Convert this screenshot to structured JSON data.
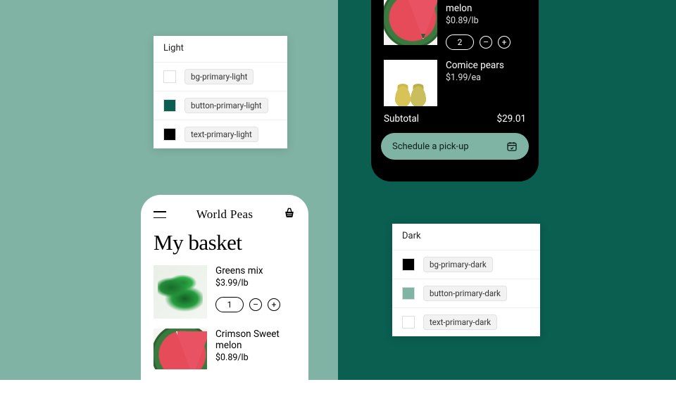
{
  "palettes": {
    "light": {
      "title": "Light",
      "rows": [
        {
          "token": "bg-primary-light",
          "hex": "#FFFFFF"
        },
        {
          "token": "button-primary-light",
          "hex": "#0A5F50"
        },
        {
          "token": "text-primary-light",
          "hex": "#000000"
        }
      ]
    },
    "dark": {
      "title": "Dark",
      "rows": [
        {
          "token": "bg-primary-dark",
          "hex": "#000000"
        },
        {
          "token": "button-primary-dark",
          "hex": "#7FB3A4"
        },
        {
          "token": "text-primary-dark",
          "hex": "#FFFFFF"
        }
      ]
    }
  },
  "light_phone": {
    "brand": "World Peas",
    "heading": "My basket",
    "items": [
      {
        "name": "Greens mix",
        "price": "$3.99/lb",
        "qty": "1"
      },
      {
        "name": "Crimson Sweet melon",
        "price": "$0.89/lb",
        "qty": ""
      }
    ]
  },
  "dark_phone": {
    "items": [
      {
        "name": "Crimson Sweet melon",
        "price": "$0.89/lb",
        "qty": "2"
      },
      {
        "name": "Comice pears",
        "price": "$1.99/ea",
        "qty": ""
      }
    ],
    "subtotal_label": "Subtotal",
    "subtotal_value": "$29.01",
    "cta": "Schedule a pick-up"
  },
  "glyphs": {
    "minus": "–",
    "plus": "+"
  }
}
